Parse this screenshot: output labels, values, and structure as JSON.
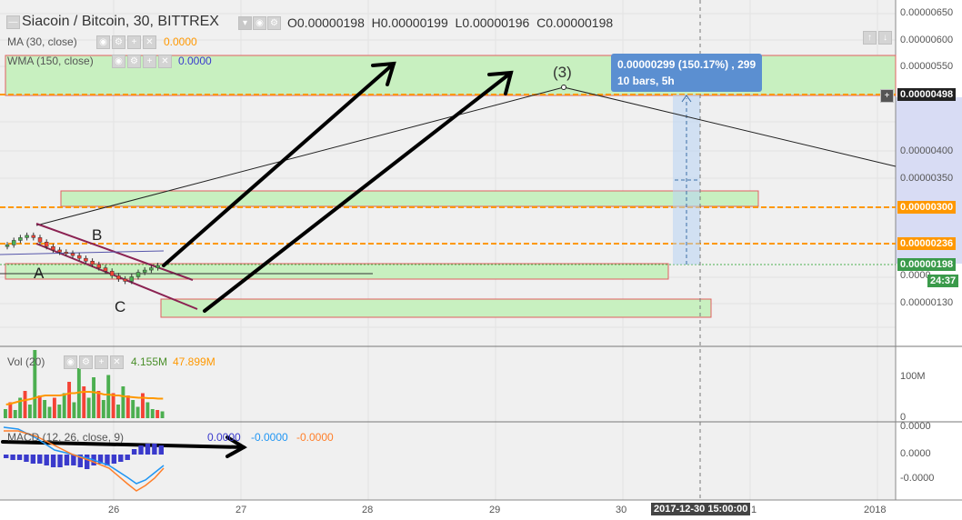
{
  "header": {
    "title": "Siacoin / Bitcoin, 30, BITTREX",
    "open_label": "O",
    "open": "0.00000198",
    "high_label": "H",
    "high": "0.00000199",
    "low_label": "L",
    "low": "0.00000196",
    "close_label": "C",
    "close": "0.00000198"
  },
  "indicators": {
    "ma_label": "MA (30, close)",
    "ma_value": "0.0000",
    "wma_label": "WMA (150, close)",
    "wma_value": "0.0000",
    "vol_label": "Vol (20)",
    "vol_value1": "4.155M",
    "vol_value2": "47.899M",
    "macd_label": "MACD (12, 26, close, 9)",
    "macd_v1": "0.0000",
    "macd_v2": "-0.0000",
    "macd_v3": "-0.0000"
  },
  "annotations": {
    "tooltip_line1": "0.00000299 (150.17%) , 299",
    "tooltip_line2": "10 bars, 5h",
    "wave3": "(3)",
    "label_a": "A",
    "label_b": "B",
    "label_c": "C"
  },
  "price_tags": {
    "current": "0.00000198",
    "countdown": "24:37",
    "level_498": "0.00000498",
    "level_300": "0.00000300",
    "level_236": "0.00000236",
    "partial_190": "0.0000",
    "crosshair_date": "2017-12-30 15:00:00",
    "crosshair_date_tail": "1"
  },
  "colors": {
    "bg": "#ffffff",
    "pane_bg": "#f0f0f0",
    "zone_fill": "#c8f0c0",
    "zone_border": "#e06060",
    "orange": "#ff9800",
    "up": "#4caf50",
    "down": "#f44336",
    "tooltip": "#5b8fd1",
    "axis_highlight": "#d8dcf4"
  },
  "chart_data": {
    "type": "candlestick",
    "title": "Siacoin / Bitcoin, 30, BITTREX",
    "price_axis_ticks": [
      "0.00000650",
      "0.00000600",
      "0.00000550",
      "0.00000400",
      "0.00000350",
      "0.00000130"
    ],
    "time_axis_ticks": [
      "26",
      "27",
      "28",
      "29",
      "30",
      "2018"
    ],
    "price_range": [
      1e-06,
      6.6e-06
    ],
    "key_levels": [
      4.98e-06,
      3e-06,
      2.36e-06,
      1.98e-06
    ],
    "zones": [
      {
        "from": 4.98e-06,
        "to": 5.7e-06
      },
      {
        "from": 2.88e-06,
        "to": 3.1e-06
      },
      {
        "from": 1.81e-06,
        "to": 2.01e-06
      },
      {
        "from": 1.27e-06,
        "to": 1.49e-06
      }
    ],
    "close_series": [
      2.35e-06,
      2.43e-06,
      2.48e-06,
      2.52e-06,
      2.48e-06,
      2.4e-06,
      2.32e-06,
      2.26e-06,
      2.22e-06,
      2.2e-06,
      2.16e-06,
      2.11e-06,
      2.06e-06,
      2e-06,
      1.94e-06,
      1.88e-06,
      1.8e-06,
      1.74e-06,
      1.7e-06,
      1.78e-06,
      1.86e-06,
      1.9e-06,
      1.94e-06,
      1.98e-06
    ],
    "volume": {
      "range": [
        0,
        150
      ],
      "tick_labels": [
        "100M",
        "0"
      ],
      "values": [
        20,
        35,
        18,
        45,
        60,
        30,
        150,
        50,
        40,
        25,
        45,
        30,
        55,
        80,
        35,
        110,
        70,
        45,
        90,
        60,
        40,
        95,
        55,
        30,
        70,
        50,
        40,
        25,
        55,
        35,
        20,
        18,
        15
      ],
      "ma_values": [
        30,
        32,
        35,
        38,
        40,
        42,
        45,
        48,
        50,
        50,
        50,
        50,
        52,
        55,
        55,
        57,
        58,
        58,
        57,
        55,
        52,
        52,
        50,
        50,
        48,
        47,
        46,
        45,
        45,
        44,
        44,
        43,
        43
      ]
    },
    "macd": {
      "tick_labels": [
        "0.0000",
        "0.0000",
        "-0.0000"
      ],
      "histogram": [
        -2,
        -3,
        -3,
        -4,
        -5,
        -5,
        -6,
        -7,
        -7,
        -6,
        -6,
        -7,
        -8,
        -6,
        -5,
        -6,
        -5,
        -4,
        -3,
        3,
        5,
        6,
        6,
        5
      ]
    },
    "projection": {
      "percent_change": "150.17%",
      "points_change": 299,
      "bars": 10,
      "duration": "5h",
      "target": 4.98e-06
    }
  }
}
